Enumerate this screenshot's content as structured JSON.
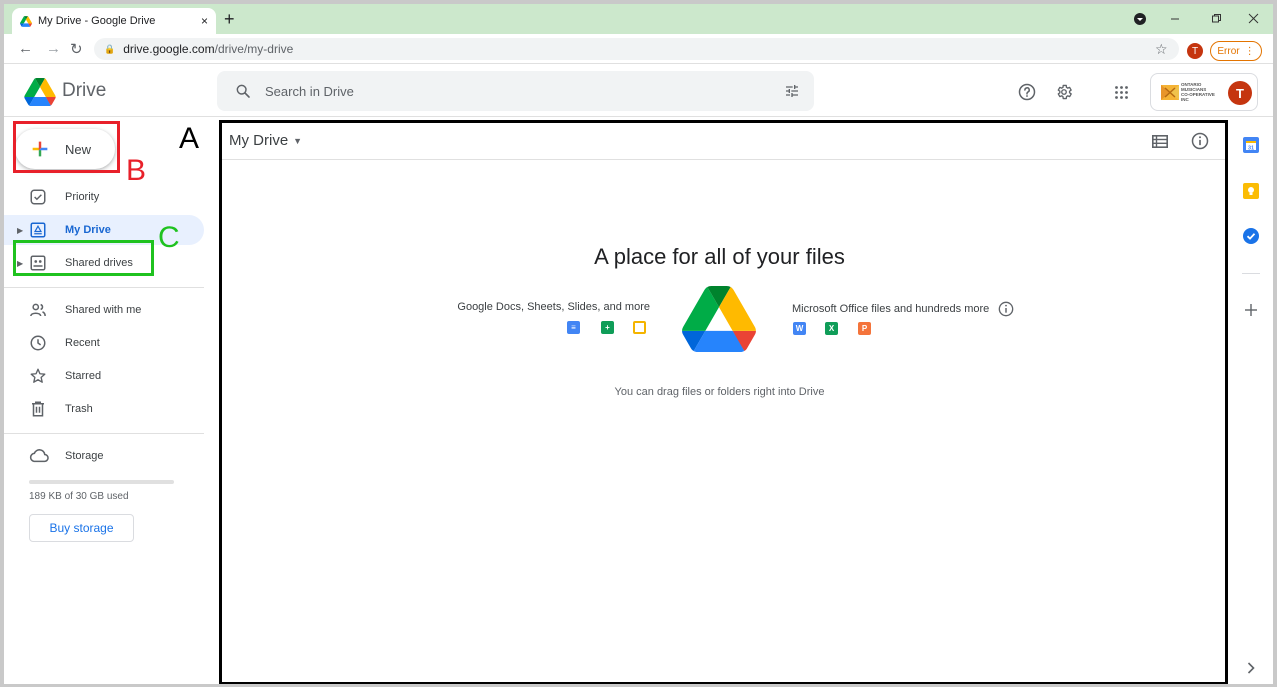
{
  "browser": {
    "tab_title": "My Drive - Google Drive",
    "new_tab_symbol": "+",
    "close_symbol": "×",
    "url_host": "drive.google.com",
    "url_path": "/drive/my-drive",
    "profile_initial": "T",
    "error_label": "Error"
  },
  "header": {
    "product_name": "Drive",
    "search_placeholder": "Search in Drive",
    "org_name_lines": [
      "ONTARIO",
      "MUSICIANS",
      "CO-OPERATIVE",
      "INC"
    ],
    "avatar_initial": "T"
  },
  "sidebar": {
    "new_label": "New",
    "items": [
      {
        "label": "Priority",
        "icon": "priority-icon"
      },
      {
        "label": "My Drive",
        "icon": "my-drive-icon",
        "active": true
      },
      {
        "label": "Shared drives",
        "icon": "shared-drives-icon"
      },
      {
        "label": "Shared with me",
        "icon": "shared-with-me-icon"
      },
      {
        "label": "Recent",
        "icon": "clock-icon"
      },
      {
        "label": "Starred",
        "icon": "star-icon"
      },
      {
        "label": "Trash",
        "icon": "trash-icon"
      },
      {
        "label": "Storage",
        "icon": "cloud-icon"
      }
    ],
    "storage_used_text": "189 KB of 30 GB used",
    "storage_fraction": 0.0,
    "buy_storage_label": "Buy storage"
  },
  "main": {
    "breadcrumb": "My Drive",
    "empty_title": "A place for all of your files",
    "left_caption": "Google Docs, Sheets, Slides, and more",
    "right_caption": "Microsoft Office files and hundreds more",
    "office_letters": [
      "W",
      "X",
      "P"
    ],
    "drag_hint": "You can drag files or folders right into Drive"
  },
  "annotations": {
    "a": "A",
    "b": "B",
    "c": "C"
  },
  "colors": {
    "accent_blue": "#1a73e8",
    "annotation_red": "#e8202a",
    "annotation_green": "#1fc21f",
    "tab_bar_green": "#cce8cc"
  }
}
